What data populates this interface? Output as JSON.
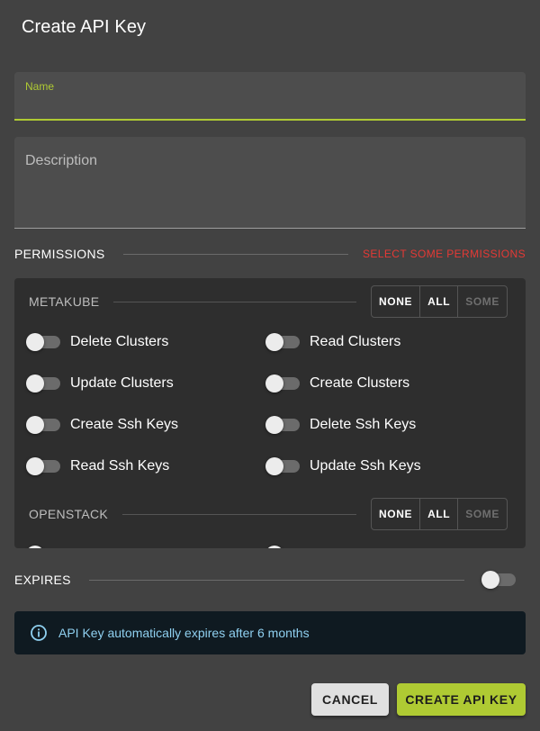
{
  "dialog": {
    "title": "Create API Key"
  },
  "name_field": {
    "label": "Name",
    "value": ""
  },
  "description_field": {
    "placeholder": "Description",
    "value": ""
  },
  "permissions": {
    "label": "PERMISSIONS",
    "hint": "SELECT SOME PERMISSIONS",
    "groups": [
      {
        "label": "METAKUBE",
        "buttons": [
          "NONE",
          "ALL",
          "SOME"
        ],
        "items": [
          {
            "label": "Delete Clusters",
            "enabled": false
          },
          {
            "label": "Read Clusters",
            "enabled": false
          },
          {
            "label": "Update Clusters",
            "enabled": false
          },
          {
            "label": "Create Clusters",
            "enabled": false
          },
          {
            "label": "Create Ssh Keys",
            "enabled": false
          },
          {
            "label": "Delete Ssh Keys",
            "enabled": false
          },
          {
            "label": "Read Ssh Keys",
            "enabled": false
          },
          {
            "label": "Update Ssh Keys",
            "enabled": false
          }
        ]
      },
      {
        "label": "OPENSTACK",
        "buttons": [
          "NONE",
          "ALL",
          "SOME"
        ]
      }
    ]
  },
  "expires": {
    "label": "EXPIRES",
    "enabled": false
  },
  "info": {
    "icon": "info-icon",
    "text": "API Key automatically expires after 6 months"
  },
  "actions": {
    "cancel_label": "CANCEL",
    "create_label": "CREATE API KEY"
  },
  "colors": {
    "accent": "#afca33",
    "error": "#e53935",
    "info_text": "#8fd0f0",
    "background": "#424242"
  }
}
